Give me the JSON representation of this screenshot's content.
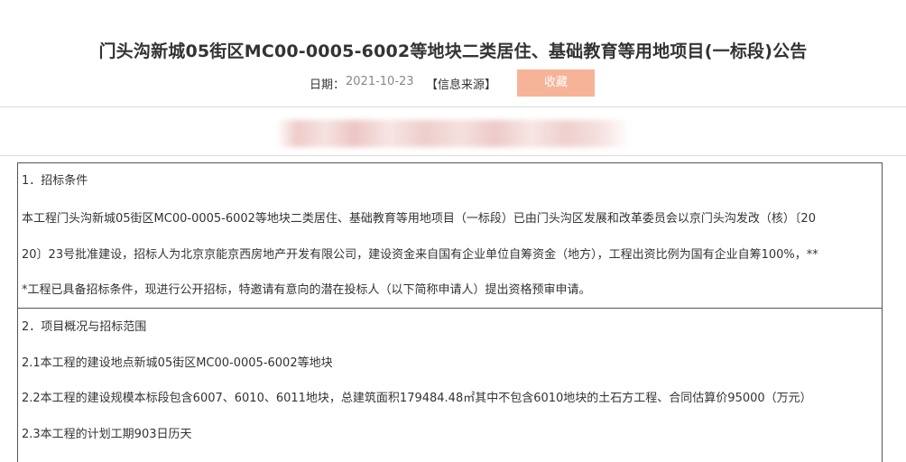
{
  "header": {
    "title": "门头沟新城05街区MC00-0005-6002等地块二类居住、基础教育等用地项目(一标段)公告",
    "date_label": "日期：",
    "date_value": "2021-10-23",
    "source_link": "【信息来源】",
    "favorite_label": "收藏"
  },
  "content": {
    "section1": {
      "heading": "1．招标条件",
      "lines": [
        "本工程门头沟新城05街区MC00-0005-6002等地块二类居住、基础教育等用地项目（一标段）已由门头沟区发展和改革委员会以京门头沟发改（核）〔20",
        "20〕23号批准建设，招标人为北京京能京西房地产开发有限公司，建设资金来自国有企业单位自筹资金（地方），工程出资比例为国有企业自筹100%，**",
        "*工程已具备招标条件，现进行公开招标，特邀请有意向的潜在投标人（以下简称申请人）提出资格预审申请。"
      ]
    },
    "section2": {
      "heading": "2．项目概况与招标范围",
      "lines": [
        "2.1本工程的建设地点新城05街区MC00-0005-6002等地块",
        "2.2本工程的建设规模本标段包含6007、6010、6011地块，总建筑面积179484.48㎡其中不包含6010地块的土石方工程、合同估算价95000（万元）",
        "2.3本工程的计划工期903日历天"
      ]
    }
  }
}
